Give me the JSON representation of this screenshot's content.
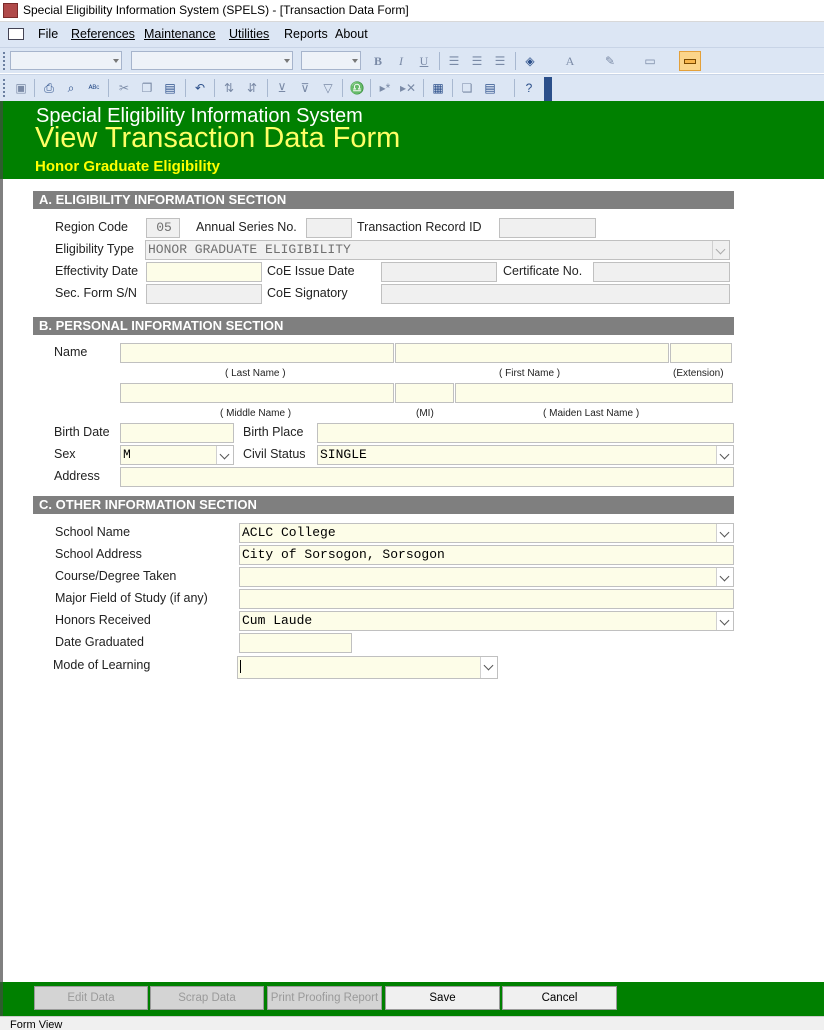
{
  "window": {
    "title": "Special Eligibility Information System (SPELS) - [Transaction Data Form]"
  },
  "menu": [
    "File",
    "References",
    "Maintenance",
    "Utilities",
    "Reports",
    "About"
  ],
  "header": {
    "system_name": "Special Eligibility Information System",
    "form_title": "View Transaction Data Form",
    "eligibility_title": "Honor Graduate Eligibility"
  },
  "section_a": {
    "title": "A.  ELIGIBILITY  INFORMATION SECTION",
    "region_code_label": "Region Code",
    "region_code": "05",
    "annual_series_label": "Annual Series No.",
    "annual_series": "",
    "transaction_id_label": "Transaction Record ID",
    "transaction_id": "",
    "eligibility_type_label": "Eligibility Type",
    "eligibility_type": "HONOR GRADUATE ELIGIBILITY",
    "effectivity_date_label": "Effectivity Date",
    "effectivity_date": "",
    "coe_issue_date_label": "CoE Issue Date",
    "coe_issue_date": "",
    "certificate_no_label": "Certificate No.",
    "certificate_no": "",
    "sec_form_label": "Sec. Form S/N",
    "sec_form": "",
    "coe_signatory_label": "CoE Signatory",
    "coe_signatory": ""
  },
  "section_b": {
    "title": "B.  PERSONAL INFORMATION SECTION",
    "name_label": "Name",
    "last_name": "",
    "first_name": "",
    "extension": "",
    "last_name_caption": "( Last Name )",
    "first_name_caption": "( First Name )",
    "extension_caption": "(Extension)",
    "middle_name": "",
    "mi": "",
    "maiden_last_name": "",
    "middle_name_caption": "( Middle Name )",
    "mi_caption": "(MI)",
    "maiden_caption": "( Maiden Last Name )",
    "birth_date_label": "Birth Date",
    "birth_date": "",
    "birth_place_label": "Birth Place",
    "birth_place": "",
    "sex_label": "Sex",
    "sex": "M",
    "civil_status_label": "Civil Status",
    "civil_status": "SINGLE",
    "address_label": "Address",
    "address": ""
  },
  "section_c": {
    "title": "C.  OTHER INFORMATION SECTION",
    "school_name_label": "School Name",
    "school_name": "ACLC College",
    "school_address_label": "School Address",
    "school_address": "City of Sorsogon, Sorsogon",
    "course_label": "Course/Degree Taken",
    "course": "",
    "major_label": "Major Field of Study (if any)",
    "major": "",
    "honors_label": "Honors Received",
    "honors": "Cum Laude",
    "date_graduated_label": "Date Graduated",
    "date_graduated": "",
    "mode_label": "Mode of Learning",
    "mode": ""
  },
  "footer": {
    "edit_data": "Edit Data",
    "scrap_data": "Scrap Data",
    "print_proofing": "Print Proofing Report",
    "save": "Save",
    "cancel": "Cancel"
  },
  "status": {
    "view": "Form View"
  },
  "colors": {
    "header_green": "#008000",
    "title_yellow": "#ffff66",
    "section_grey": "#7f7f7f",
    "field_bg": "#fdfde8",
    "toolbar_blue": "#dce6f4"
  }
}
